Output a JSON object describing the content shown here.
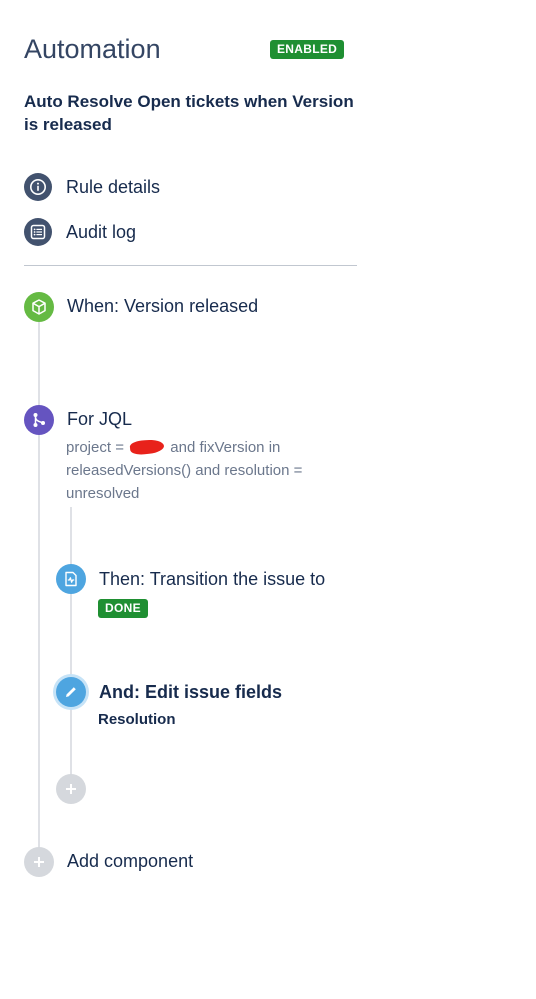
{
  "header": {
    "title": "Automation",
    "status": "ENABLED"
  },
  "rule": {
    "name": "Auto Resolve Open tickets when Version is released"
  },
  "nav": {
    "rule_details": "Rule details",
    "audit_log": "Audit log"
  },
  "flow": {
    "trigger": "When: Version released",
    "branch": {
      "title": "For JQL",
      "jql_prefix": "project =",
      "jql_suffix": "and fixVersion in releasedVersions() and resolution = unresolved"
    },
    "then": {
      "label": "Then: Transition the issue to",
      "status": "DONE"
    },
    "and": {
      "label": "And: Edit issue fields",
      "field": "Resolution"
    },
    "add_component": "Add component"
  },
  "colors": {
    "success_green": "#1f8f32",
    "trigger_green": "#65ba43",
    "branch_purple": "#6554c0",
    "action_blue": "#4ea5e0",
    "nav_icon": "#42526e"
  }
}
